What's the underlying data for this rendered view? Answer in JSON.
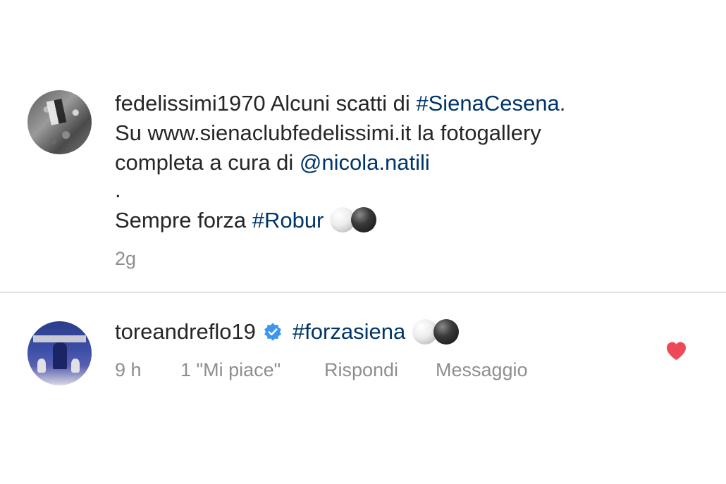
{
  "post": {
    "username": "fedelissimi1970",
    "text_1": " Alcuni scatti di ",
    "hashtag_1": "#SienaCesena",
    "text_2": ".",
    "line_2": "Su www.sienaclubfedelissimi.it la fotogallery",
    "line_3_text": "completa a cura di ",
    "mention": "@nicola.natili",
    "dot_line": ".",
    "line_5_text": "Sempre forza ",
    "hashtag_2": "#Robur",
    "emoji": [
      "white-circle-icon",
      "black-circle-icon"
    ],
    "time": "2g"
  },
  "comment": {
    "username": "toreandreflo19",
    "verified": true,
    "hashtag": "#forzasiena",
    "emoji": [
      "white-circle-icon",
      "black-circle-icon"
    ],
    "time": "9 h",
    "likes_label": "1 \"Mi piace\"",
    "reply_label": "Rispondi",
    "message_label": "Messaggio",
    "liked": true
  },
  "colors": {
    "text": "#262626",
    "link": "#003569",
    "meta": "#8e8e8e",
    "verified": "#3897f0",
    "heart": "#ed4956",
    "divider": "#e2e2e2"
  }
}
